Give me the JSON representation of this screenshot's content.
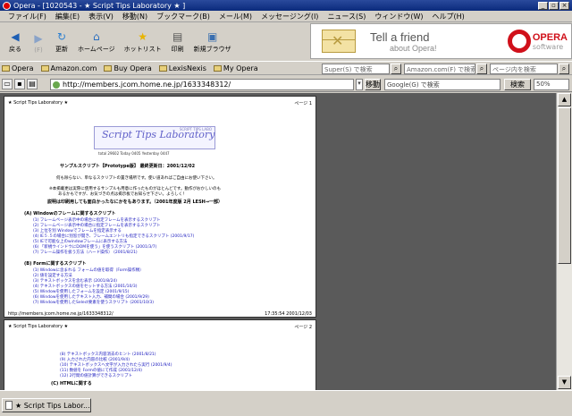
{
  "window": {
    "title": "Opera - [1020543 - ★ Script Tips Laboratory ★ ]",
    "controls": [
      "_",
      "▫",
      "×"
    ]
  },
  "menu": [
    "ファイル(F)",
    "編集(E)",
    "表示(V)",
    "移動(N)",
    "ブックマーク(B)",
    "メール(M)",
    "メッセージング(I)",
    "ニュース(S)",
    "ウィンドウ(W)",
    "ヘルプ(H)"
  ],
  "toolbar": {
    "back": "戻る",
    "forward": "(F)",
    "reload": "更新",
    "home": "ホームページ",
    "hotlist": "ホットリスト",
    "print": "印刷",
    "new_window": "新規ブラウザ"
  },
  "ad": {
    "tagline1": "Tell a friend",
    "tagline2": "about Opera!",
    "brand": "OPERA",
    "brand_sub": "software"
  },
  "personal_bar": [
    "Opera",
    "Amazon.com",
    "Buy Opera",
    "LexisNexis",
    "My Opera"
  ],
  "search": {
    "super": "Super(S) で検索",
    "amazon": "Amazon.com(F) で検索",
    "page": "ページ内を検索"
  },
  "address": {
    "url": "http://members.jcom.home.ne.jp/1633348312/",
    "go_button": "移動",
    "google_placeholder": "Google(G) で検索",
    "search_button": "検索",
    "zoom": "50%"
  },
  "document": {
    "header_left": "★ Script Tips Laboratory ★",
    "header_right": "ページ 1",
    "banner_title": "Script Tips Laboratory",
    "banner_sub": "SCRIPT TIPS LABO",
    "subnav": "total 29602  Today 0405  Yesterday 0447",
    "intro_title": "サンプルスクリプト【Prototype版】 最終更新日：2001/12/02",
    "intro1": "何も除らない、単なるスクリプトの置き場所です。使い道あればご自由にお使い下さい。",
    "intro2": "※本掲載更は実際に使用するサンプルも用意に作ったものがほとんどです。動作がおかしいのも",
    "intro3": "あるかもですが、お気づきの点は掲示板でお知らせ下さい。よろしく！",
    "intro4": "説明は印刷用しても面白かったなにかをもあります。（2001年度版 2月 LESH→一部）",
    "section1": "(A) Windowのフレームに関するスクリプト",
    "links1": [
      "(1) フレームページ表示中の場合に指定フレームを表示するスクリプト",
      "(2) フレームページ表示中の場合に指定フレームを表示するスクリプト",
      "(3) 上位を別 Windowでフレームを指定表示する",
      "(4) IE５.５の場合に別窓が開き、フレームエントリも指定できるスクリプト (2001/9/17)",
      "(5) IEで可能な上のwindowフレームに表示する方法",
      "(6) 「新規ウインドウにDOMを使う」を使うスクリプト (2001/3/7)",
      "(7) フレーム操作を扱う方法（ハード操作） (2001/8/21)"
    ],
    "section2": "(B) Formに関するスクリプト",
    "links2": [
      "(1) Windowに含まれる フォームの値を取得（Form操作類）",
      "(2) 値を設定する方法",
      "(3) テキストボックスを含む表示 (2001/8/24)",
      "(4) テキストボックスの値をセットする方法 (2001/10/3)",
      "(5) Windowを使用したフォームを設定 (2001/9/15)",
      "(6) Windowを使用したテキスト入力、補間の場合 (2001/9/29)",
      "(7) Windowを使用したSelect要素を使うスクリプト (2001/10/3)"
    ],
    "footer_url": "http://members.jcom.home.ne.jp/1633348312/",
    "footer_time": "17:35:54 2001/12/03",
    "page2_header_left": "★ Script Tips Laboratory ★",
    "page2_header_right": "ページ 2",
    "links3": [
      "(8) テキストボックス内容消去のヒント (2001/8/21)",
      "(9) 入力された内容の比較 (2001/9/4)",
      "(10) テキストボックスへ文字が入力されたら実行 (2001/9/4)",
      "(11) 数値を Formの値にて作成 (2001/12/4)",
      "(12) 2行間の値計算ができるスクリプト"
    ],
    "section3": "(C) HTMLに関する"
  },
  "status": {
    "tab_label": "★ Script Tips Labor..."
  }
}
